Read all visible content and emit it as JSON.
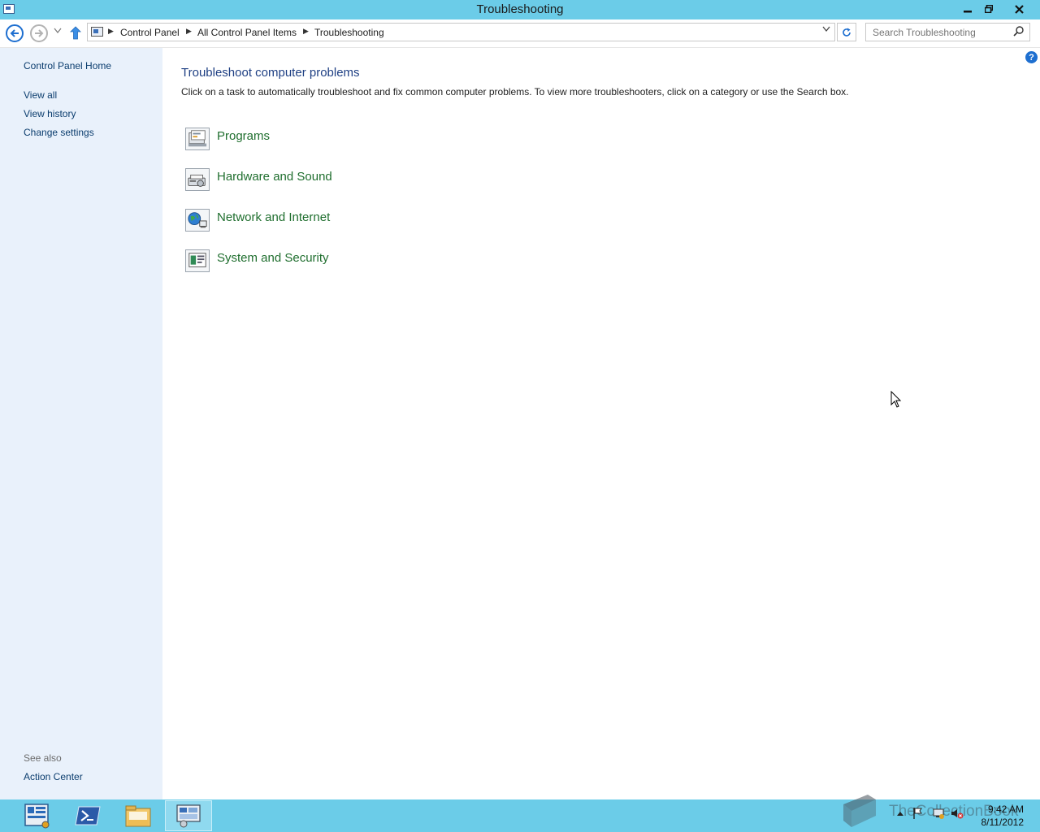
{
  "window": {
    "title": "Troubleshooting"
  },
  "address": {
    "crumbs": [
      "Control Panel",
      "All Control Panel Items",
      "Troubleshooting"
    ]
  },
  "search": {
    "placeholder": "Search Troubleshooting"
  },
  "sidebar": {
    "home": "Control Panel Home",
    "links": [
      "View all",
      "View history",
      "Change settings"
    ],
    "see_also_label": "See also",
    "see_also_links": [
      "Action Center"
    ]
  },
  "main": {
    "heading": "Troubleshoot computer problems",
    "description": "Click on a task to automatically troubleshoot and fix common computer problems. To view more troubleshooters, click on a category or use the Search box.",
    "categories": [
      {
        "label": "Programs",
        "icon": "programs-icon"
      },
      {
        "label": "Hardware and Sound",
        "icon": "hardware-sound-icon"
      },
      {
        "label": "Network and Internet",
        "icon": "network-internet-icon"
      },
      {
        "label": "System and Security",
        "icon": "system-security-icon"
      }
    ]
  },
  "taskbar": {
    "time": "9:42 AM",
    "date": "8/11/2012",
    "watermark": "TheCollectionBook",
    "buttons": [
      "server-manager-icon",
      "powershell-icon",
      "file-explorer-icon",
      "control-panel-icon"
    ]
  },
  "colors": {
    "titlebar": "#6bcce8",
    "sidebar": "#e9f1fb",
    "heading": "#1e3f83",
    "category_link": "#1f6e2e"
  }
}
